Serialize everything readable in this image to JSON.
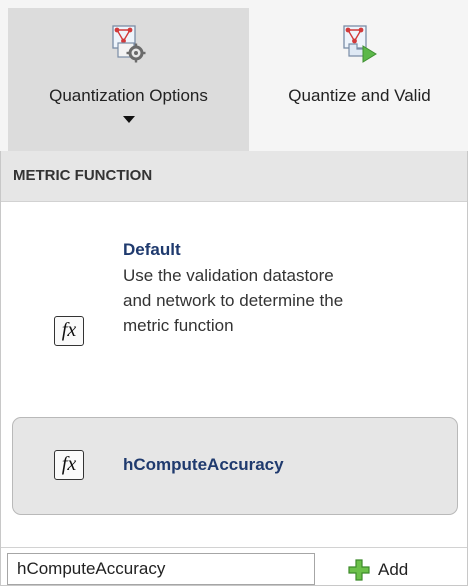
{
  "toolstrip": {
    "quantization_options": {
      "label": "Quantization Options",
      "icon": "network-settings-icon"
    },
    "quantize_validate": {
      "label": "Quantize and Valid",
      "icon": "network-run-icon"
    }
  },
  "metric_panel": {
    "header": "METRIC FUNCTION",
    "items": [
      {
        "icon": "fx-icon",
        "title": "Default",
        "description": "Use the validation datastore and network to determine the metric function"
      },
      {
        "icon": "fx-icon",
        "title": "hComputeAccuracy",
        "selected": true
      }
    ],
    "footer": {
      "input_value": "hComputeAccuracy",
      "add_label": "Add"
    },
    "fx_glyph": "fx"
  },
  "colors": {
    "title_blue": "#1f3a6e",
    "plus_green": "#6cc04a"
  }
}
